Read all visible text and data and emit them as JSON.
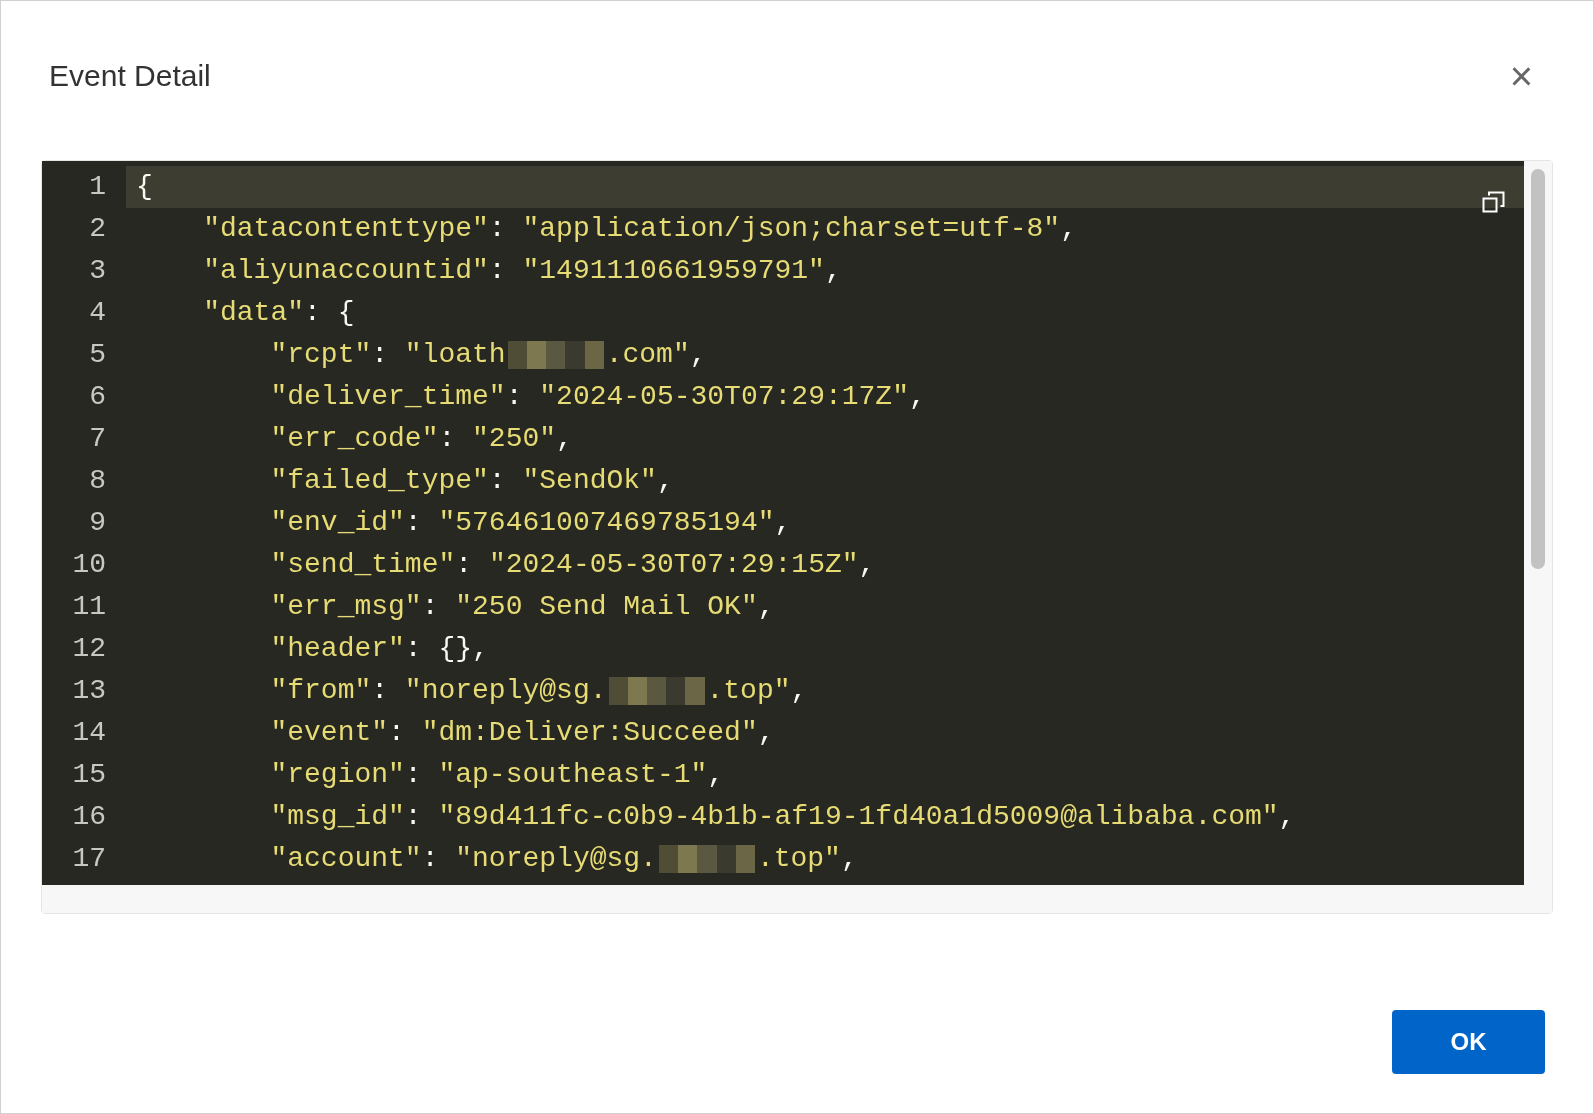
{
  "dialog": {
    "title": "Event Detail",
    "close": "×",
    "ok_button": "OK"
  },
  "editor": {
    "lines": [
      {
        "number": "1",
        "highlighted": true,
        "segments": [
          {
            "kind": "punct",
            "text": "{"
          }
        ]
      },
      {
        "number": "2",
        "highlighted": false,
        "segments": [
          {
            "kind": "str",
            "text": "    \"datacontenttype\""
          },
          {
            "kind": "punct",
            "text": ": "
          },
          {
            "kind": "str",
            "text": "\"application/json;charset=utf-8\""
          },
          {
            "kind": "punct",
            "text": ","
          }
        ]
      },
      {
        "number": "3",
        "highlighted": false,
        "segments": [
          {
            "kind": "str",
            "text": "    \"aliyunaccountid\""
          },
          {
            "kind": "punct",
            "text": ": "
          },
          {
            "kind": "str",
            "text": "\"1491110661959791\""
          },
          {
            "kind": "punct",
            "text": ","
          }
        ]
      },
      {
        "number": "4",
        "highlighted": false,
        "segments": [
          {
            "kind": "str",
            "text": "    \"data\""
          },
          {
            "kind": "punct",
            "text": ": {"
          }
        ]
      },
      {
        "number": "5",
        "highlighted": false,
        "segments": [
          {
            "kind": "str",
            "text": "        \"rcpt\""
          },
          {
            "kind": "punct",
            "text": ": "
          },
          {
            "kind": "str",
            "text": "\"loath"
          },
          {
            "kind": "redacted"
          },
          {
            "kind": "str",
            "text": ".com\""
          },
          {
            "kind": "punct",
            "text": ","
          }
        ]
      },
      {
        "number": "6",
        "highlighted": false,
        "segments": [
          {
            "kind": "str",
            "text": "        \"deliver_time\""
          },
          {
            "kind": "punct",
            "text": ": "
          },
          {
            "kind": "str",
            "text": "\"2024-05-30T07:29:17Z\""
          },
          {
            "kind": "punct",
            "text": ","
          }
        ]
      },
      {
        "number": "7",
        "highlighted": false,
        "segments": [
          {
            "kind": "str",
            "text": "        \"err_code\""
          },
          {
            "kind": "punct",
            "text": ": "
          },
          {
            "kind": "str",
            "text": "\"250\""
          },
          {
            "kind": "punct",
            "text": ","
          }
        ]
      },
      {
        "number": "8",
        "highlighted": false,
        "segments": [
          {
            "kind": "str",
            "text": "        \"failed_type\""
          },
          {
            "kind": "punct",
            "text": ": "
          },
          {
            "kind": "str",
            "text": "\"SendOk\""
          },
          {
            "kind": "punct",
            "text": ","
          }
        ]
      },
      {
        "number": "9",
        "highlighted": false,
        "segments": [
          {
            "kind": "str",
            "text": "        \"env_id\""
          },
          {
            "kind": "punct",
            "text": ": "
          },
          {
            "kind": "str",
            "text": "\"576461007469785194\""
          },
          {
            "kind": "punct",
            "text": ","
          }
        ]
      },
      {
        "number": "10",
        "highlighted": false,
        "segments": [
          {
            "kind": "str",
            "text": "        \"send_time\""
          },
          {
            "kind": "punct",
            "text": ": "
          },
          {
            "kind": "str",
            "text": "\"2024-05-30T07:29:15Z\""
          },
          {
            "kind": "punct",
            "text": ","
          }
        ]
      },
      {
        "number": "11",
        "highlighted": false,
        "segments": [
          {
            "kind": "str",
            "text": "        \"err_msg\""
          },
          {
            "kind": "punct",
            "text": ": "
          },
          {
            "kind": "str",
            "text": "\"250 Send Mail OK\""
          },
          {
            "kind": "punct",
            "text": ","
          }
        ]
      },
      {
        "number": "12",
        "highlighted": false,
        "segments": [
          {
            "kind": "str",
            "text": "        \"header\""
          },
          {
            "kind": "punct",
            "text": ": {},"
          }
        ]
      },
      {
        "number": "13",
        "highlighted": false,
        "segments": [
          {
            "kind": "str",
            "text": "        \"from\""
          },
          {
            "kind": "punct",
            "text": ": "
          },
          {
            "kind": "str",
            "text": "\"noreply@sg."
          },
          {
            "kind": "redacted"
          },
          {
            "kind": "str",
            "text": ".top\""
          },
          {
            "kind": "punct",
            "text": ","
          }
        ]
      },
      {
        "number": "14",
        "highlighted": false,
        "segments": [
          {
            "kind": "str",
            "text": "        \"event\""
          },
          {
            "kind": "punct",
            "text": ": "
          },
          {
            "kind": "str",
            "text": "\"dm:Deliver:Succeed\""
          },
          {
            "kind": "punct",
            "text": ","
          }
        ]
      },
      {
        "number": "15",
        "highlighted": false,
        "segments": [
          {
            "kind": "str",
            "text": "        \"region\""
          },
          {
            "kind": "punct",
            "text": ": "
          },
          {
            "kind": "str",
            "text": "\"ap-southeast-1\""
          },
          {
            "kind": "punct",
            "text": ","
          }
        ]
      },
      {
        "number": "16",
        "highlighted": false,
        "segments": [
          {
            "kind": "str",
            "text": "        \"msg_id\""
          },
          {
            "kind": "punct",
            "text": ": "
          },
          {
            "kind": "str",
            "text": "\"89d411fc-c0b9-4b1b-af19-1fd40a1d5009@alibaba.com\""
          },
          {
            "kind": "punct",
            "text": ","
          }
        ]
      },
      {
        "number": "17",
        "highlighted": false,
        "segments": [
          {
            "kind": "str",
            "text": "        \"account\""
          },
          {
            "kind": "punct",
            "text": ": "
          },
          {
            "kind": "str",
            "text": "\"noreply@sg."
          },
          {
            "kind": "redacted"
          },
          {
            "kind": "str",
            "text": ".top\""
          },
          {
            "kind": "punct",
            "text": ","
          }
        ]
      }
    ]
  }
}
